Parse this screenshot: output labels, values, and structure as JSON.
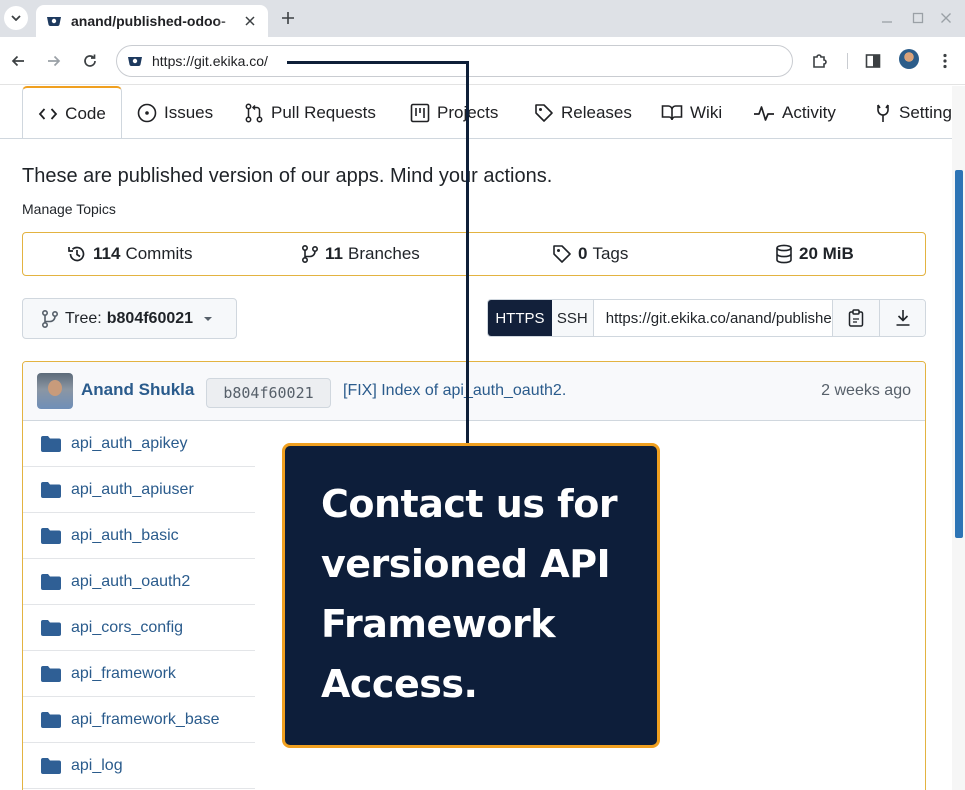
{
  "browser": {
    "tab_title": "anand/published-odoo-",
    "url": "https://git.ekika.co/"
  },
  "repo_nav": {
    "tabs": [
      {
        "label": "Code",
        "icon": "code-icon"
      },
      {
        "label": "Issues",
        "icon": "issue-icon"
      },
      {
        "label": "Pull Requests",
        "icon": "pull-request-icon"
      },
      {
        "label": "Projects",
        "icon": "project-icon"
      },
      {
        "label": "Releases",
        "icon": "tag-icon"
      },
      {
        "label": "Wiki",
        "icon": "book-icon"
      },
      {
        "label": "Activity",
        "icon": "pulse-icon"
      },
      {
        "label": "Settings",
        "icon": "tools-icon"
      }
    ]
  },
  "repo": {
    "description": "These are published version of our apps. Mind your actions.",
    "manage_topics": "Manage Topics",
    "stats": {
      "commits_count": "114",
      "commits_label": "Commits",
      "branches_count": "11",
      "branches_label": "Branches",
      "tags_count": "0",
      "tags_label": "Tags",
      "size": "20 MiB"
    },
    "tree": {
      "label": "Tree:",
      "ref": "b804f60021"
    },
    "clone": {
      "https_label": "HTTPS",
      "ssh_label": "SSH",
      "url": "https://git.ekika.co/anand/published-odoo-apps.git"
    },
    "latest_commit": {
      "author": "Anand Shukla",
      "sha": "b804f60021",
      "message": "[FIX] Index of api_auth_oauth2.",
      "time": "2 weeks ago"
    },
    "files": [
      {
        "name": "api_auth_apikey",
        "type": "folder"
      },
      {
        "name": "api_auth_apiuser",
        "type": "folder"
      },
      {
        "name": "api_auth_basic",
        "type": "folder"
      },
      {
        "name": "api_auth_oauth2",
        "type": "folder"
      },
      {
        "name": "api_cors_config",
        "type": "folder"
      },
      {
        "name": "api_framework",
        "type": "folder"
      },
      {
        "name": "api_framework_base",
        "type": "folder"
      },
      {
        "name": "api_log",
        "type": "folder"
      }
    ]
  },
  "callout": {
    "lines": [
      "Contact us for",
      "versioned API",
      "Framework",
      "Access."
    ]
  },
  "colors": {
    "accent": "#f0a020",
    "callout_bg": "#0d1e3a",
    "link": "#2a5b8c",
    "folder": "#2f5f95"
  }
}
